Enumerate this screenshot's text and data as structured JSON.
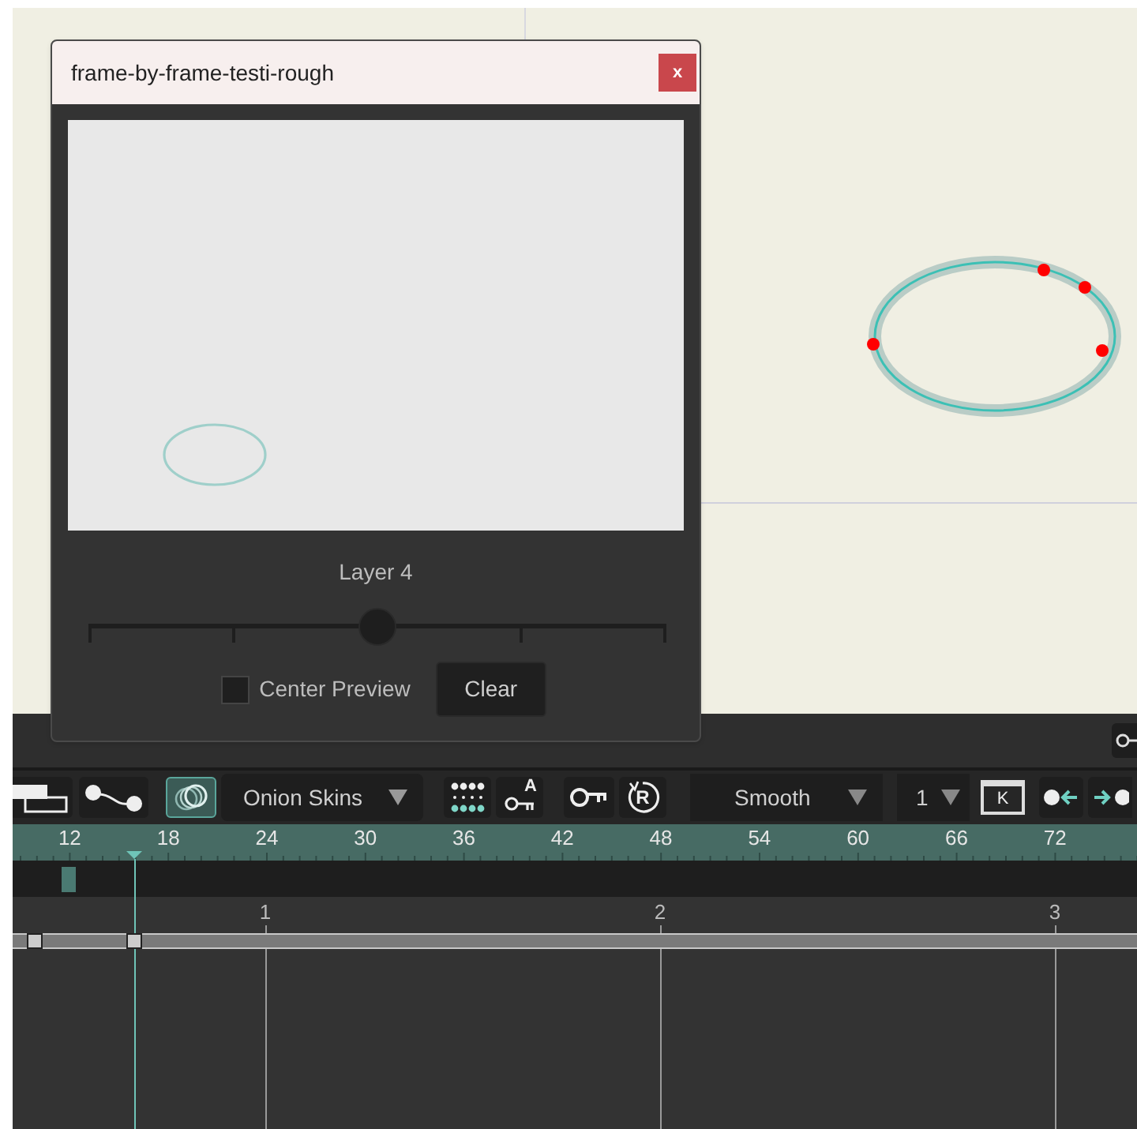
{
  "dialog": {
    "title": "frame-by-frame-testi-rough",
    "close_label": "x",
    "layer_label": "Layer 4",
    "slider": {
      "level": 0.5
    },
    "center_preview": {
      "label": "Center Preview",
      "checked": false
    },
    "clear_button": "Clear"
  },
  "toolbar": {
    "onion_toggle": {
      "on": true
    },
    "onion_dropdown": "Onion Skins",
    "key_a_label": "A",
    "key_r_label": "R",
    "interpolation_dropdown": "Smooth",
    "step_dropdown": "1",
    "key_button": "K"
  },
  "ruler": {
    "labels": [
      "12",
      "18",
      "24",
      "30",
      "36",
      "42",
      "48",
      "54",
      "60",
      "66",
      "72"
    ]
  },
  "graph": {
    "labels": [
      "1",
      "2",
      "3"
    ]
  }
}
